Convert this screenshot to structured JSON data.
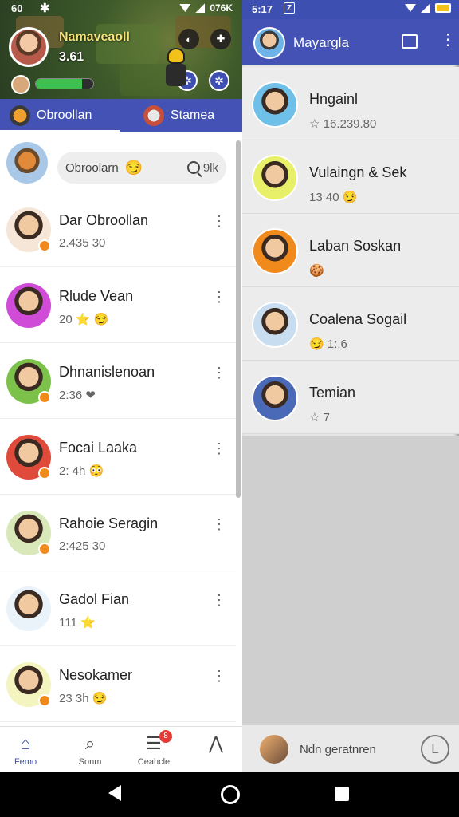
{
  "status_left": {
    "time": "60",
    "battery": "076K"
  },
  "status_right": {
    "time": "5:17",
    "notification_badge": "Z"
  },
  "game_header": {
    "profile_name": "Namaveaoll",
    "profile_score": "3.61",
    "health_fraction": 0.8
  },
  "left_tabs": [
    {
      "label": "Obroollan",
      "active": true
    },
    {
      "label": "Stamea",
      "active": false
    }
  ],
  "search": {
    "value": "Obroolarn",
    "emoji": "😏",
    "count": "9lk"
  },
  "chats": [
    {
      "name": "Dar Obroollan",
      "sub": "2.435 30",
      "emoji": "",
      "avatar_color": "#f5e6d8",
      "badge": true
    },
    {
      "name": "Rlude Vean",
      "sub": "20",
      "emoji": "⭐ 😏",
      "avatar_color": "#d04bd8",
      "badge": false
    },
    {
      "name": "Dhnanislenoan",
      "sub": "2:36",
      "emoji": "❤",
      "avatar_color": "#7cc24a",
      "badge": true
    },
    {
      "name": "Focai Laaka",
      "sub": "2: 4h",
      "emoji": "😳",
      "avatar_color": "#e04a3a",
      "badge": true
    },
    {
      "name": "Rahoie Seragin",
      "sub": "2:425 30",
      "emoji": "",
      "avatar_color": "#d8e8b8",
      "badge": true
    },
    {
      "name": "Gadol Fian",
      "sub": "111",
      "emoji": "⭐",
      "avatar_color": "#eaf2fa",
      "badge": false
    },
    {
      "name": "Nesokamer",
      "sub": "23 3h",
      "emoji": "😏",
      "avatar_color": "#f4f4c0",
      "badge": true
    }
  ],
  "bottom_nav": [
    {
      "label": "Femo",
      "icon": "home-icon",
      "active": true
    },
    {
      "label": "Sonm",
      "icon": "search-icon",
      "active": false
    },
    {
      "label": "Ceahcle",
      "icon": "chat-icon",
      "active": false,
      "badge": "8"
    },
    {
      "label": "",
      "icon": "trophy-icon",
      "active": false
    }
  ],
  "right_toolbar": {
    "title": "Mayargla"
  },
  "contacts": [
    {
      "name": "Hngainl",
      "sub": "16.239.80",
      "prefix": "☆",
      "avatar_color": "#6ec0e8"
    },
    {
      "name": "Vulaingn & Sek",
      "sub": "13 40",
      "suffix": "😏",
      "avatar_color": "#e8f06a"
    },
    {
      "name": "Laban Soskan",
      "sub": "",
      "prefix": "🍪",
      "avatar_color": "#f08a1c"
    },
    {
      "name": "Coalena Sogail",
      "sub": "1:.6",
      "prefix": "😏",
      "avatar_color": "#c8def0"
    },
    {
      "name": "Temian",
      "sub": "7",
      "prefix": "☆",
      "avatar_color": "#4a6ab8"
    }
  ],
  "right_footer": {
    "text": "Ndn geratnren",
    "clock_letter": "L"
  },
  "colors": {
    "brand": "#4352b4",
    "accent_orange": "#f08a1c",
    "status_blue": "#3d4fb0"
  }
}
